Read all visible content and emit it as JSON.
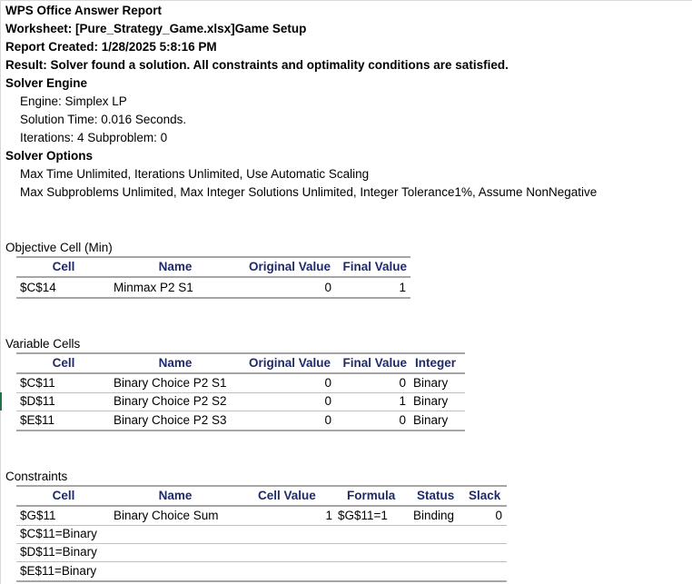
{
  "header": {
    "title": "WPS Office Answer Report",
    "worksheet": "Worksheet: [Pure_Strategy_Game.xlsx]Game Setup",
    "created": "Report Created: 1/28/2025 5:8:16 PM",
    "result": "Result: Solver found a solution. All constraints and optimality conditions are satisfied."
  },
  "engine": {
    "heading": "Solver Engine",
    "engine": "Engine: Simplex LP",
    "solution_time": "Solution Time: 0.016 Seconds.",
    "iterations": "Iterations: 4 Subproblem: 0"
  },
  "options": {
    "heading": "Solver Options",
    "line1": "Max Time Unlimited, Iterations Unlimited, Use Automatic Scaling",
    "line2": "Max Subproblems Unlimited, Max Integer Solutions Unlimited, Integer Tolerance1%, Assume NonNegative"
  },
  "objective": {
    "title": "Objective Cell (Min)",
    "headers": {
      "cell": "Cell",
      "name": "Name",
      "original": "Original Value",
      "final": "Final Value"
    },
    "rows": [
      {
        "cell": "$C$14",
        "name": "Minmax P2 S1",
        "original": "0",
        "final": "1"
      }
    ]
  },
  "variables": {
    "title": "Variable Cells",
    "headers": {
      "cell": "Cell",
      "name": "Name",
      "original": "Original Value",
      "final": "Final Value",
      "integer": "Integer"
    },
    "rows": [
      {
        "cell": "$C$11",
        "name": "Binary Choice P2 S1",
        "original": "0",
        "final": "0",
        "integer": "Binary"
      },
      {
        "cell": "$D$11",
        "name": "Binary Choice P2 S2",
        "original": "0",
        "final": "1",
        "integer": "Binary"
      },
      {
        "cell": "$E$11",
        "name": "Binary Choice P2 S3",
        "original": "0",
        "final": "0",
        "integer": "Binary"
      }
    ]
  },
  "constraints": {
    "title": "Constraints",
    "headers": {
      "cell": "Cell",
      "name": "Name",
      "value": "Cell Value",
      "formula": "Formula",
      "status": "Status",
      "slack": "Slack"
    },
    "rows": [
      {
        "cell": "$G$11",
        "name": "Binary Choice Sum",
        "value": "1",
        "formula": "$G$11=1",
        "status": "Binding",
        "slack": "0"
      },
      {
        "cell": "$C$11=Binary"
      },
      {
        "cell": "$D$11=Binary"
      },
      {
        "cell": "$E$11=Binary"
      }
    ]
  },
  "colors": {
    "header_text": "#1f2a6b",
    "selection_marker": "#217346",
    "rule": "#a6a6a6"
  }
}
